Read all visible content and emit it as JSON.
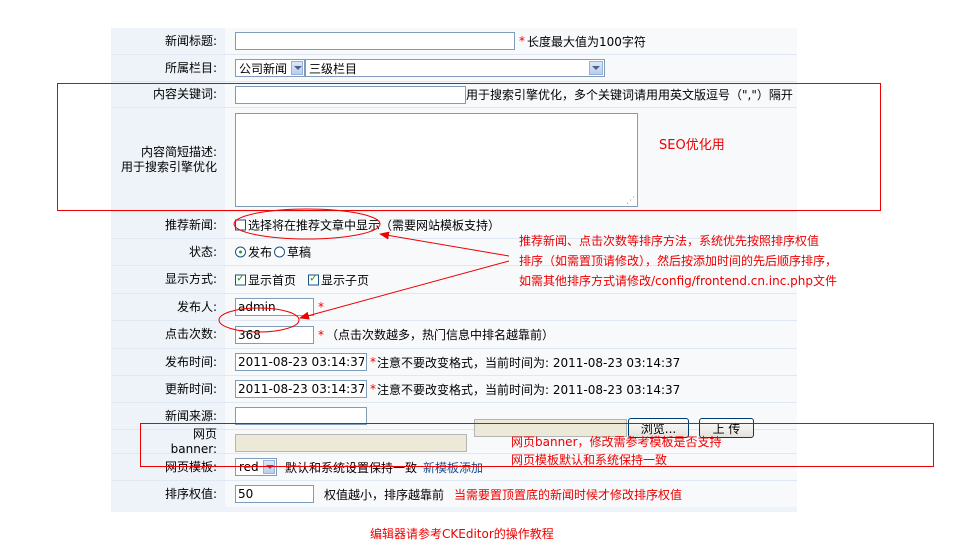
{
  "fields": {
    "title": {
      "label": "新闻标题:",
      "value": "",
      "hint": "长度最大值为100字符"
    },
    "category": {
      "label": "所属栏目:",
      "select1": "公司新闻",
      "select2": "三级栏目"
    },
    "keywords": {
      "label": "内容关键词:",
      "value": "",
      "hint": "用于搜索引擎优化，多个关键词请用用英文版逗号（\",\"）隔开"
    },
    "description": {
      "label_line1": "内容简短描述:",
      "label_line2": "用于搜索引擎优化",
      "value": ""
    },
    "recommend": {
      "label": "推荐新闻:",
      "option": "选择将在推荐文章中显示（需要网站模板支持）",
      "checked": false
    },
    "status": {
      "label": "状态:",
      "option_publish": "发布",
      "option_draft": "草稿",
      "selected": "发布"
    },
    "display": {
      "label": "显示方式:",
      "option_home": "显示首页",
      "option_sub": "显示子页",
      "home_checked": true,
      "sub_checked": true
    },
    "publisher": {
      "label": "发布人:",
      "value": "admin"
    },
    "clicks": {
      "label": "点击次数:",
      "value": "368",
      "hint": "（点击次数越多，热门信息中排名越靠前）"
    },
    "publish_time": {
      "label": "发布时间:",
      "value": "2011-08-23 03:14:37",
      "hint": "注意不要改变格式，当前时间为: 2011-08-23 03:14:37"
    },
    "update_time": {
      "label": "更新时间:",
      "value": "2011-08-23 03:14:37",
      "hint": "注意不要改变格式，当前时间为: 2011-08-23 03:14:37"
    },
    "source": {
      "label": "新闻来源:",
      "value": ""
    },
    "banner": {
      "label": "网页banner:",
      "value": "",
      "browse_label": "浏览...",
      "upload_label": "上 传"
    },
    "template": {
      "label": "网页模板:",
      "select": "red",
      "hint": "默认和系统设置保持一致",
      "link": "新模板添加"
    },
    "sort": {
      "label": "排序权值:",
      "value": "50",
      "hint": "权值越小，排序越靠前",
      "note": "当需要置顶置底的新闻时候才修改排序权值"
    }
  },
  "annotations": {
    "seo": "SEO优化用",
    "sort_line1": "推荐新闻、点击次数等排序方法，系统优先按照排序权值",
    "sort_line2": "排序（如需置顶请修改），然后按添加时间的先后顺序排序，",
    "sort_line3": "如需其他排序方式请修改/config/frontend.cn.inc.php文件",
    "banner_line1": "网页banner，修改需参考模板是否支持",
    "banner_line2": "网页模板默认和系统保持一致",
    "footer": "编辑器请参考CKEditor的操作教程"
  },
  "colors": {
    "annotation": "#ee0000",
    "label_bg": "#eef3f9",
    "value_bg": "#f7f9fb",
    "link": "#1a4b8c"
  }
}
